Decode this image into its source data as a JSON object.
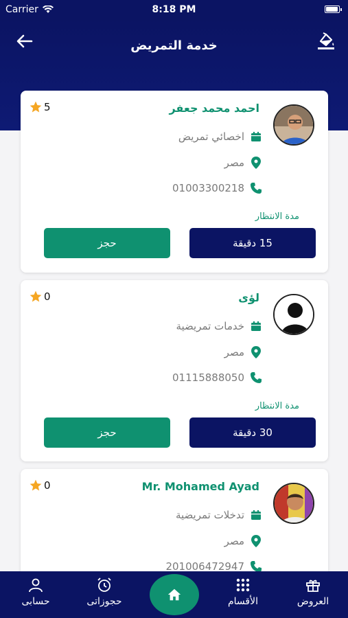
{
  "status_bar": {
    "carrier": "Carrier",
    "time": "8:18 PM",
    "battery_level": 0.95
  },
  "header": {
    "title": "خدمة التمريض",
    "back_icon": "arrow-left-icon",
    "paint_icon": "paint-bucket-icon"
  },
  "providers": [
    {
      "name": "احمد محمد جعفر",
      "rating": "5",
      "specialty": "اخصائي تمريض",
      "location": "مصر",
      "phone": "01003300218",
      "wait_label": "مدة الانتظار",
      "wait_time": "15 دقيقة",
      "book_label": "حجز",
      "avatar": "man-glasses-avatar"
    },
    {
      "name": "لؤى",
      "rating": "0",
      "specialty": "خدمات تمريضية",
      "location": "مصر",
      "phone": "01115888050",
      "wait_label": "مدة الانتظار",
      "wait_time": "30 دقيقة",
      "book_label": "حجز",
      "avatar": "default-person-avatar"
    },
    {
      "name": "Mr. Mohamed Ayad",
      "rating": "0",
      "specialty": "تدخلات تمريضية",
      "location": "مصر",
      "phone": "201006472947",
      "avatar": "man-smiling-avatar"
    }
  ],
  "tabbar": {
    "account": "حسابى",
    "bookings": "حجوزاتى",
    "sections": "الأقسام",
    "offers": "العروض"
  },
  "colors": {
    "navy": "#0b1463",
    "green": "#0f9170",
    "star": "#f5a623",
    "gray_text": "#7a7a7a"
  }
}
